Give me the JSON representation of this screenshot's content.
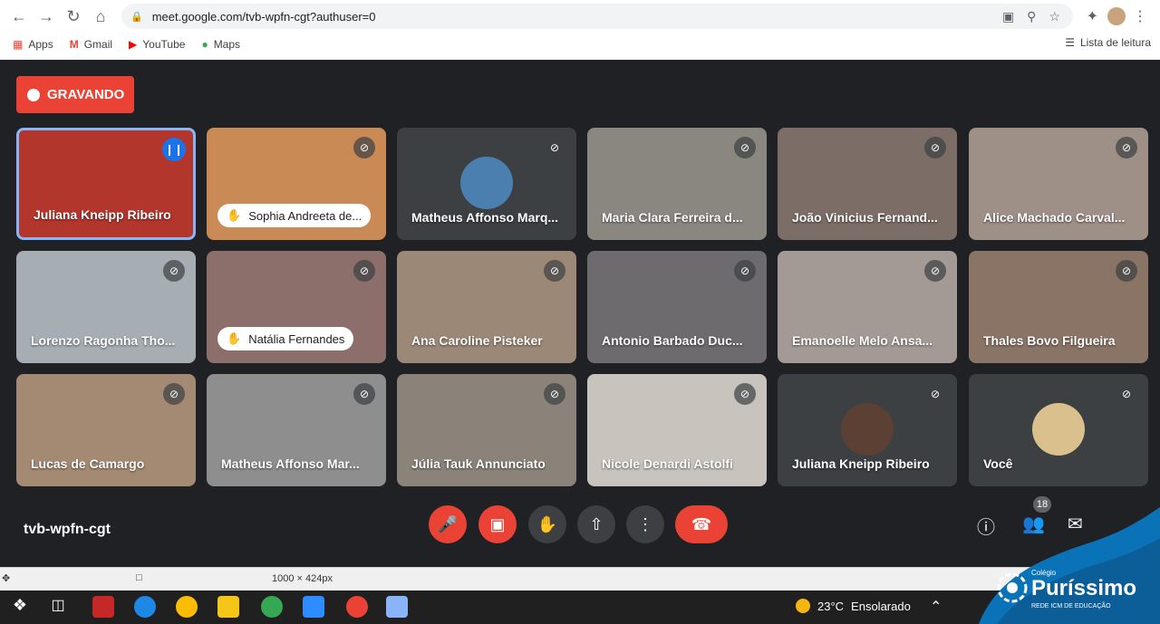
{
  "browser": {
    "url": "meet.google.com/tvb-wpfn-cgt?authuser=0",
    "bookmarks": [
      "Apps",
      "Gmail",
      "YouTube",
      "Maps"
    ],
    "reading_list": "Lista de leitura"
  },
  "recording": {
    "label": "GRAVANDO"
  },
  "participants": [
    {
      "name": "Juliana Kneipp Ribeiro",
      "color": "#b3362d"
    },
    {
      "name": "Sophia Andreeta de...",
      "color": "#c98a55",
      "hand": true
    },
    {
      "name": "Matheus Affonso Marq...",
      "color": "#3c4043",
      "avatar": "#4a7fb0"
    },
    {
      "name": "Maria Clara Ferreira d...",
      "color": "#8a8680"
    },
    {
      "name": "João Vinicius Fernand...",
      "color": "#7c6d66"
    },
    {
      "name": "Alice Machado Carval...",
      "color": "#9e8f87"
    },
    {
      "name": "Lorenzo Ragonha Tho...",
      "color": "#a7aeb3"
    },
    {
      "name": "Natália Fernandes",
      "color": "#8c6f6a",
      "hand": true
    },
    {
      "name": "Ana Caroline Pisteker",
      "color": "#9c8876"
    },
    {
      "name": "Antonio Barbado Duc...",
      "color": "#6d6b6e"
    },
    {
      "name": "Emanoelle Melo Ansa...",
      "color": "#a39a95"
    },
    {
      "name": "Thales Bovo Filgueira",
      "color": "#8a7466"
    },
    {
      "name": "Lucas de Camargo",
      "color": "#a58a73"
    },
    {
      "name": "Matheus Affonso Mar...",
      "color": "#8e8e8e"
    },
    {
      "name": "Júlia Tauk Annunciato",
      "color": "#8b8279"
    },
    {
      "name": "Nicole Denardi Astolfi",
      "color": "#c8c3bd"
    },
    {
      "name": "Juliana Kneipp Ribeiro",
      "color": "#3c4043",
      "avatar": "#5b4033"
    },
    {
      "name": "Você",
      "color": "#3c4043",
      "avatar": "#d9c08c"
    }
  ],
  "meeting_code": "tvb-wpfn-cgt",
  "participants_count": "18",
  "status": {
    "dims": "1000 × 424px"
  },
  "weather": {
    "temp": "23°C",
    "label": "Ensolarado"
  },
  "brand": {
    "small": "Colégio",
    "name": "Puríssimo",
    "tag": "REDE ICM DE EDUCAÇÃO"
  }
}
